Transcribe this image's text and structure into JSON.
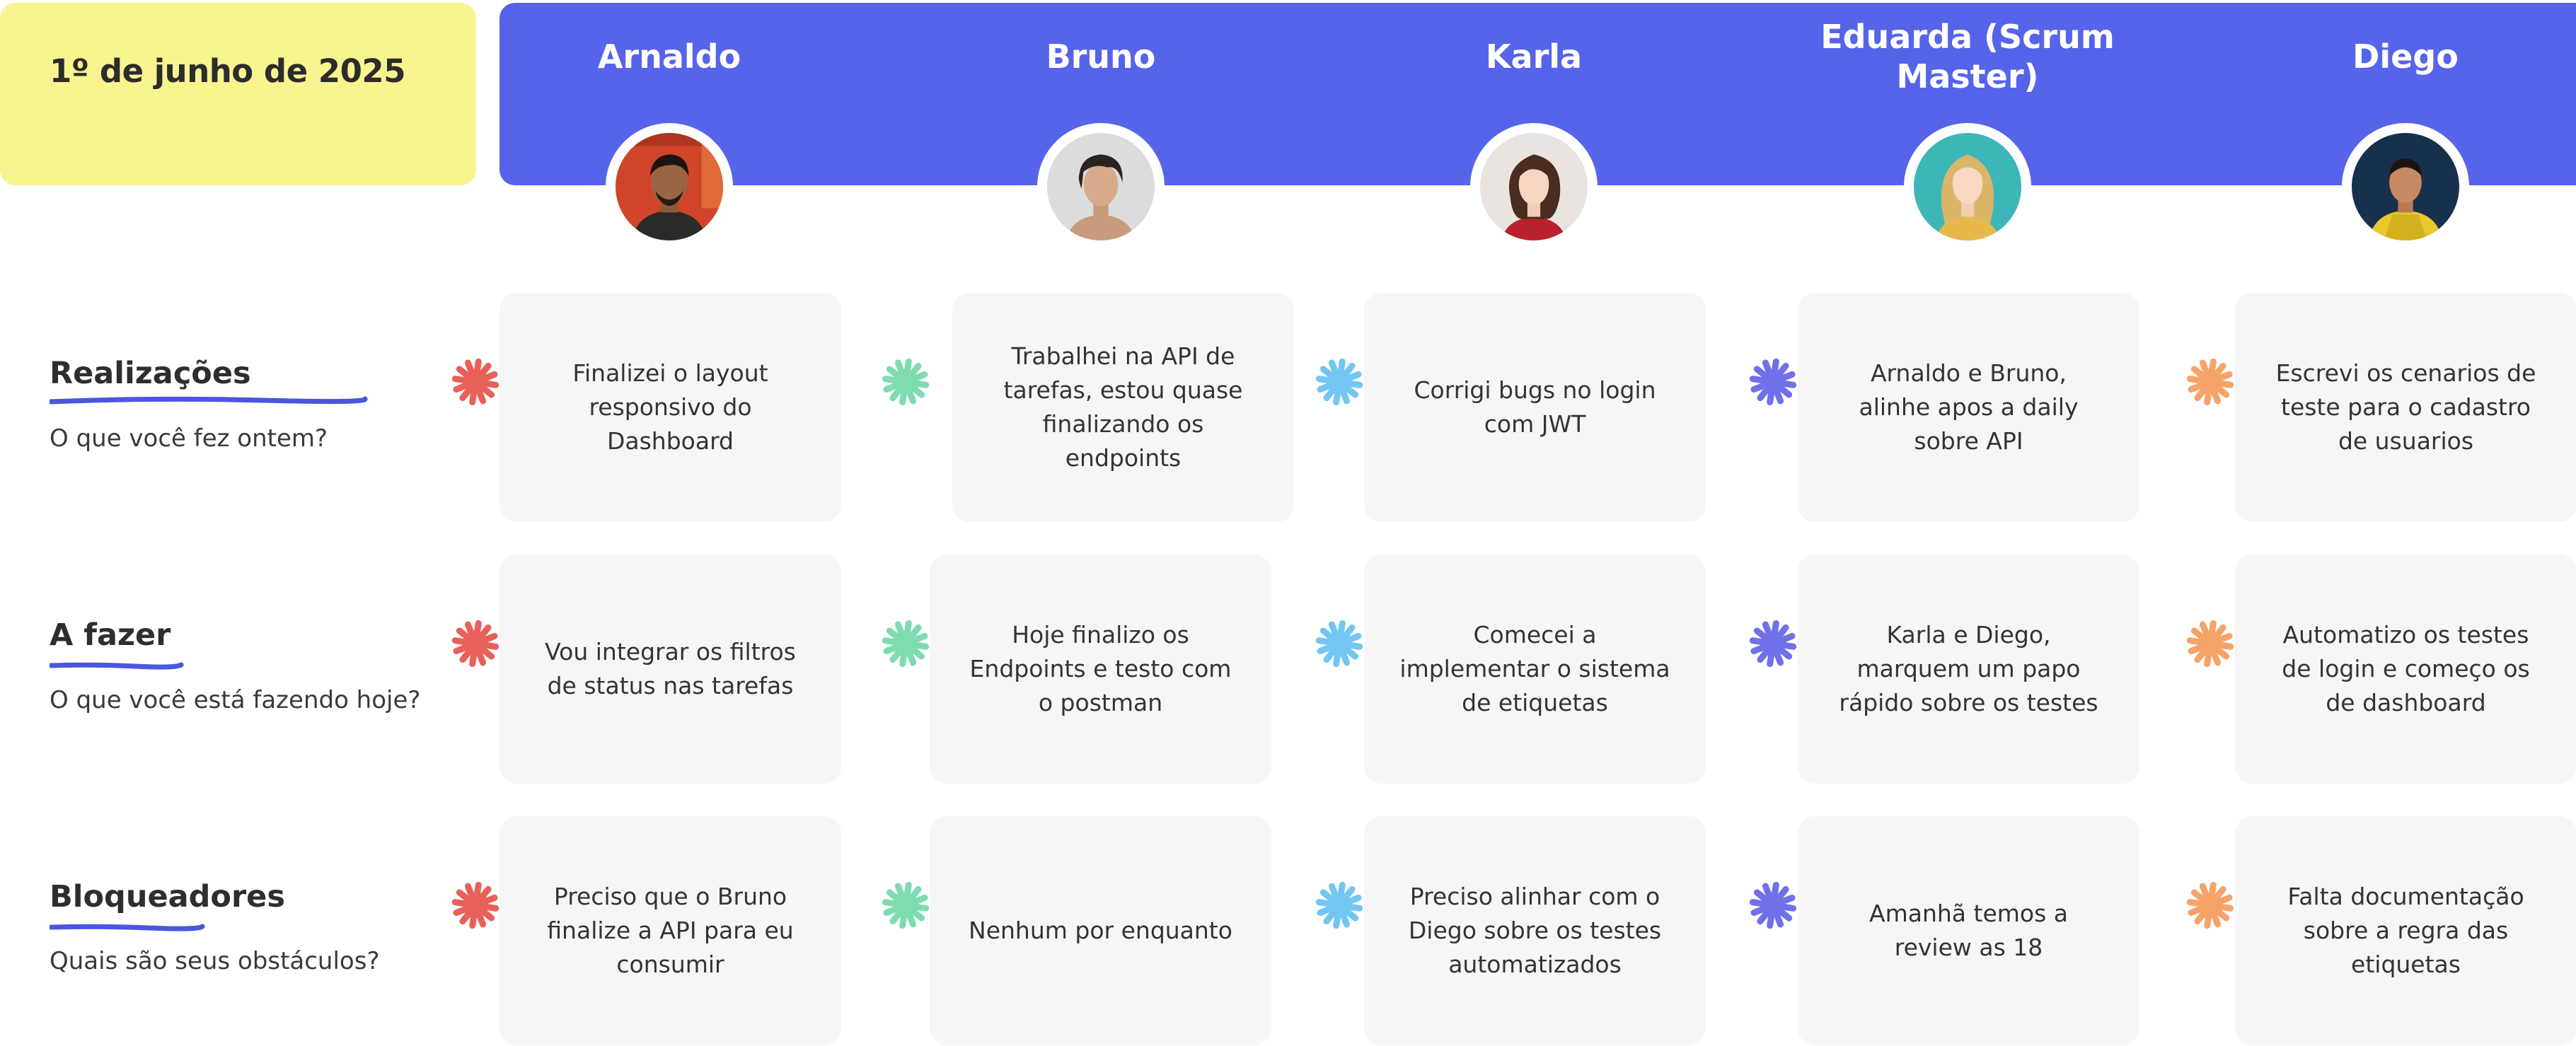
{
  "header": {
    "date": "1º de junho de 2025"
  },
  "colors": {
    "banner": "#5664ea",
    "date_box": "#f8f48f",
    "card": "#f6f6f6"
  },
  "members": [
    {
      "name": "Arnaldo",
      "star_color": "#e8605a",
      "avatar_bg": "#d0452a"
    },
    {
      "name": "Bruno",
      "star_color": "#7fdcb0",
      "avatar_bg": "#dcdcdc"
    },
    {
      "name": "Karla",
      "star_color": "#73c6f2",
      "avatar_bg": "#e9e4df"
    },
    {
      "name": "Eduarda (Scrum Master)",
      "star_color": "#7070e8",
      "avatar_bg": "#3db6b8"
    },
    {
      "name": "Diego",
      "star_color": "#f6a36a",
      "avatar_bg": "#17304d"
    }
  ],
  "sections": [
    {
      "title": "Realizações",
      "subtitle": "O que você fez ontem?",
      "cards": [
        "Finalizei o layout responsivo do Dashboard",
        "Trabalhei na API de tarefas, estou quase finalizando os endpoints",
        "Corrigi bugs no login com JWT",
        "Arnaldo e Bruno, alinhe apos a daily sobre API",
        "Escrevi os cenarios de teste para o cadastro de usuarios"
      ]
    },
    {
      "title": "A fazer",
      "subtitle": "O que você está fazendo hoje?",
      "cards": [
        "Vou integrar os filtros de status nas tarefas",
        "Hoje finalizo os Endpoints e testo com o postman",
        "Comecei a implementar o sistema de etiquetas",
        "Karla e Diego, marquem um papo rápido sobre os testes",
        "Automatizo os testes de login e começo os de dashboard"
      ]
    },
    {
      "title": "Bloqueadores",
      "subtitle": "Quais são seus obstáculos?",
      "cards": [
        "Preciso que o Bruno finalize a API para eu consumir",
        "Nenhum por enquanto",
        "Preciso alinhar com o Diego sobre os testes automatizados",
        "Amanhã temos a review as 18",
        "Falta documentação sobre a regra das etiquetas"
      ]
    }
  ]
}
